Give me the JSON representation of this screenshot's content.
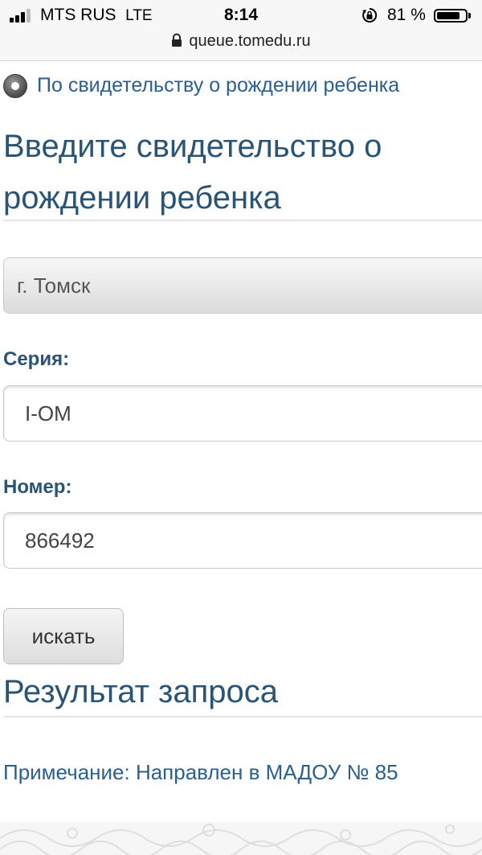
{
  "status_bar": {
    "carrier": "MTS RUS",
    "network": "LTE",
    "time": "8:14",
    "battery_percent": "81 %",
    "battery_level": 0.81,
    "url": "queue.tomedu.ru"
  },
  "search_mode": {
    "label": "По свидетельству о рождении ребенка",
    "selected": true
  },
  "form": {
    "title": "Введите свидетельство о рождении ребенка",
    "city_select": {
      "value": "г. Томск"
    },
    "series": {
      "label": "Серия:",
      "value": "I-ОМ"
    },
    "number": {
      "label": "Номер:",
      "value": "866492"
    },
    "search_button": "искать"
  },
  "result": {
    "title": "Результат запроса",
    "note": "Примечание: Направлен в МАДОУ № 85"
  },
  "colors": {
    "heading": "#2a5475",
    "link": "#2a5f8e",
    "field_border": "#c8c8c8"
  }
}
